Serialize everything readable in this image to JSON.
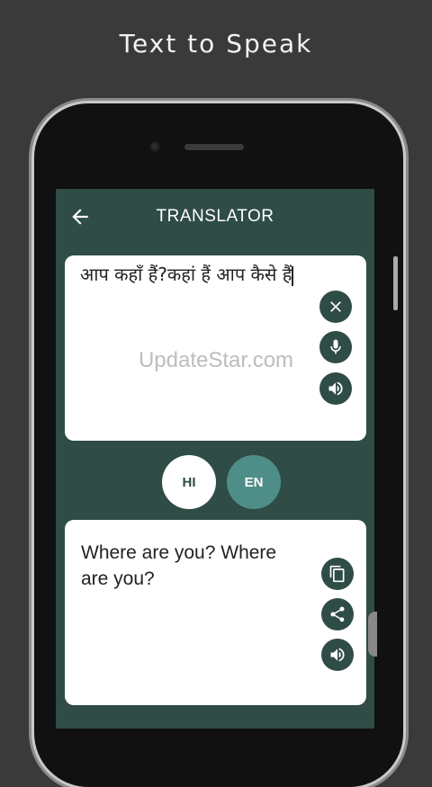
{
  "banner": {
    "title": "Text to Speak"
  },
  "appbar": {
    "title": "TRANSLATOR",
    "back_icon": "arrow-left-icon"
  },
  "input_card": {
    "text": "आप कहाँ हैं?कहां हैं आप कैसे हैं",
    "actions": [
      {
        "icon": "close-icon"
      },
      {
        "icon": "microphone-icon"
      },
      {
        "icon": "speaker-icon"
      }
    ]
  },
  "languages": {
    "source": "HI",
    "target": "EN"
  },
  "output_card": {
    "text": "Where are you? Where are you?",
    "actions": [
      {
        "icon": "copy-icon"
      },
      {
        "icon": "share-icon"
      },
      {
        "icon": "speaker-icon"
      }
    ]
  },
  "watermark": "UpdateStar.com",
  "colors": {
    "background": "#3a3a3a",
    "screen": "#2f4c46",
    "accent": "#4f8d88",
    "card": "#ffffff"
  }
}
